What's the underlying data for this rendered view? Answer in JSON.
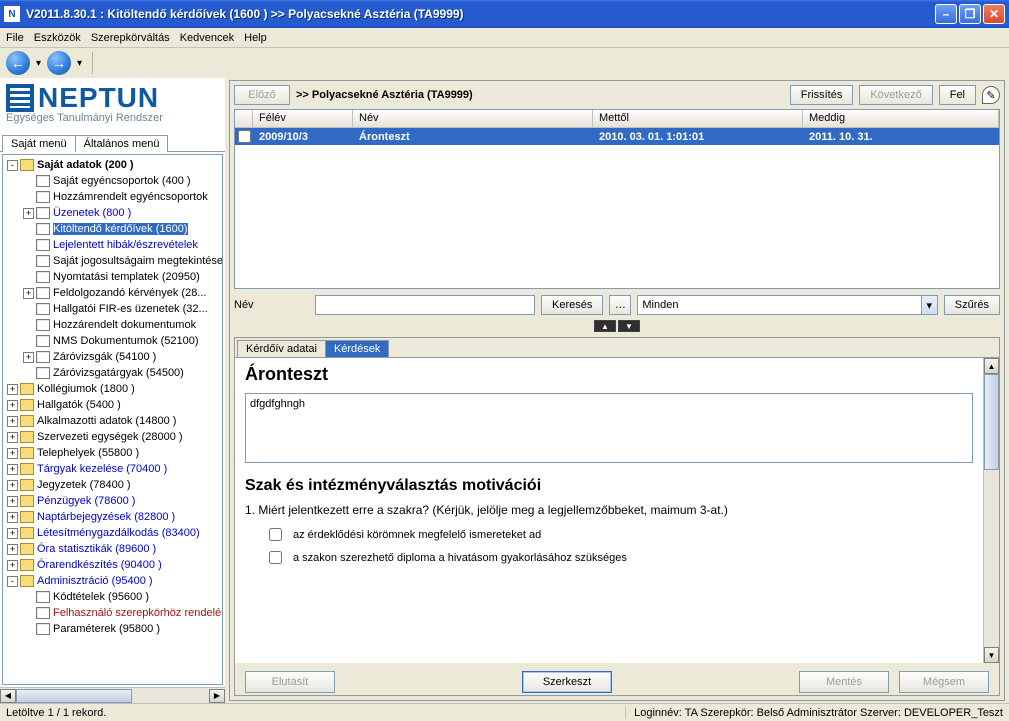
{
  "window": {
    "title": "V2011.8.30.1 : Kitöltendő kérdőívek (1600  )   >> Polyacsekné Asztéria (TA9999)"
  },
  "menu": {
    "file": "File",
    "tools": "Eszközök",
    "rolechange": "Szerepkörváltás",
    "favs": "Kedvencek",
    "help": "Help"
  },
  "sidebar": {
    "logo_sub": "Egységes Tanulmányi Rendszer",
    "tab1": "Saját menü",
    "tab2": "Általános menü",
    "items": [
      {
        "ind": 1,
        "exp": "-",
        "icon": "group",
        "label": "Saját adatok (200  )",
        "bold": true
      },
      {
        "ind": 2,
        "exp": "",
        "icon": "form",
        "label": "Saját egyéncsoportok (400  )"
      },
      {
        "ind": 2,
        "exp": "",
        "icon": "form",
        "label": "Hozzámrendelt egyéncsoportok"
      },
      {
        "ind": 2,
        "exp": "+",
        "icon": "form",
        "label": "Üzenetek (800  )",
        "blue": true
      },
      {
        "ind": 2,
        "exp": "",
        "icon": "form",
        "label": "Kitöltendő kérdőívek (1600)",
        "sel": true
      },
      {
        "ind": 2,
        "exp": "",
        "icon": "form",
        "label": "Lejelentett hibák/észrevételek",
        "blue": true
      },
      {
        "ind": 2,
        "exp": "",
        "icon": "form",
        "label": "Saját jogosultságaim megtekintése"
      },
      {
        "ind": 2,
        "exp": "",
        "icon": "form",
        "label": "Nyomtatási templatek (20950)"
      },
      {
        "ind": 2,
        "exp": "+",
        "icon": "form",
        "label": "Feldolgozandó kérvények (28..."
      },
      {
        "ind": 2,
        "exp": "",
        "icon": "form",
        "label": "Hallgatói FIR-es üzenetek (32..."
      },
      {
        "ind": 2,
        "exp": "",
        "icon": "form",
        "label": "Hozzárendelt dokumentumok"
      },
      {
        "ind": 2,
        "exp": "",
        "icon": "form",
        "label": "NMS Dokumentumok (52100)"
      },
      {
        "ind": 2,
        "exp": "+",
        "icon": "form",
        "label": "Záróvizsgák (54100  )"
      },
      {
        "ind": 2,
        "exp": "",
        "icon": "form",
        "label": "Záróvizsgatárgyak (54500)"
      },
      {
        "ind": 1,
        "exp": "+",
        "icon": "group",
        "label": "Kollégiumok (1800  )"
      },
      {
        "ind": 1,
        "exp": "+",
        "icon": "group",
        "label": "Hallgatók (5400  )"
      },
      {
        "ind": 1,
        "exp": "+",
        "icon": "group",
        "label": "Alkalmazotti adatok (14800  )"
      },
      {
        "ind": 1,
        "exp": "+",
        "icon": "group",
        "label": "Szervezeti egységek (28000  )"
      },
      {
        "ind": 1,
        "exp": "+",
        "icon": "group",
        "label": "Telephelyek (55800  )"
      },
      {
        "ind": 1,
        "exp": "+",
        "icon": "group",
        "label": "Tárgyak kezelése (70400  )",
        "blue": true
      },
      {
        "ind": 1,
        "exp": "+",
        "icon": "group",
        "label": "Jegyzetek (78400  )"
      },
      {
        "ind": 1,
        "exp": "+",
        "icon": "group",
        "label": "Pénzügyek (78600  )",
        "blue": true
      },
      {
        "ind": 1,
        "exp": "+",
        "icon": "group",
        "label": "Naptárbejegyzések (82800  )",
        "blue": true
      },
      {
        "ind": 1,
        "exp": "+",
        "icon": "group",
        "label": "Létesítménygazdálkodás (83400)",
        "blue": true
      },
      {
        "ind": 1,
        "exp": "+",
        "icon": "group",
        "label": "Óra statisztikák (89600  )",
        "blue": true
      },
      {
        "ind": 1,
        "exp": "+",
        "icon": "group",
        "label": "Órarendkészítés (90400  )",
        "blue": true
      },
      {
        "ind": 1,
        "exp": "-",
        "icon": "group",
        "label": "Adminisztráció (95400  )",
        "blue": true
      },
      {
        "ind": 2,
        "exp": "",
        "icon": "form",
        "label": "Kódtételek (95600  )"
      },
      {
        "ind": 2,
        "exp": "",
        "icon": "form",
        "label": "Felhasználó szerepkörhöz rendelés",
        "red": true
      },
      {
        "ind": 2,
        "exp": "",
        "icon": "form",
        "label": "Paraméterek (95800  )"
      }
    ]
  },
  "content": {
    "prev": "Előző",
    "refresh": "Frissítés",
    "next": "Következő",
    "up": "Fel",
    "path": ">>  Polyacsekné Asztéria (TA9999)",
    "cols": {
      "c1": "Félév",
      "c2": "Név",
      "c3": "Mettől",
      "c4": "Meddig"
    },
    "row": {
      "c1": "2009/10/3",
      "c2": "Áronteszt",
      "c3": "2010. 03. 01. 1:01:01",
      "c4": "2011. 10. 31."
    },
    "name_lbl": "Név",
    "search": "Keresés",
    "filter": "Szűrés",
    "all": "Minden",
    "tab_data": "Kérdőív adatai",
    "tab_q": "Kérdések",
    "form_title": "Áronteszt",
    "form_text": "dfgdfghngh",
    "section": "Szak és intézményválasztás motivációi",
    "q1": "1. Miért jelentkezett erre a szakra? (Kérjük, jelölje meg a legjellemzőbbeket, maimum 3-at.)",
    "opt1": "az érdeklődési körömnek megfelelő ismereteket ad",
    "opt2": "a szakon szerezhető diploma a hivatásom gyakorlásához szükséges",
    "reject": "Elutasít",
    "edit": "Szerkeszt",
    "save": "Mentés",
    "cancel": "Mégsem"
  },
  "status": {
    "left": "Letöltve 1 / 1 rekord.",
    "right": "Loginnév: TA   Szerepkör: Belső Adminisztrátor   Szerver: DEVELOPER_Teszt"
  }
}
